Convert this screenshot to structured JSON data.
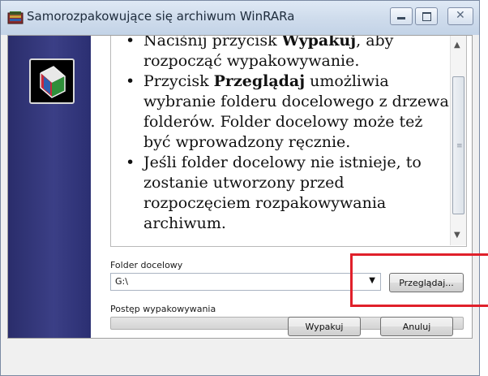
{
  "window": {
    "title": "Samorozpakowujące się archiwum WinRARa",
    "title_icon": "winrar-archive-icon",
    "controls": [
      "minimize",
      "maximize",
      "close"
    ]
  },
  "sidebar": {
    "logo": "winrar-books-logo"
  },
  "info": {
    "items": [
      {
        "before": "Naciśnij przycisk ",
        "bold": "Wypakuj",
        "after": ", aby rozpocząć wypakowywanie."
      },
      {
        "before": "Przycisk ",
        "bold": "Przeglądaj",
        "after": " umożliwia wybranie folderu docelowego z drzewa folderów. Folder docelowy może też być wprowadzony ręcznie."
      },
      {
        "before": "Jeśli folder docelowy nie istnieje, to zostanie utworzony przed rozpoczęciem rozpakowywania archiwum.",
        "bold": "",
        "after": ""
      }
    ]
  },
  "destination": {
    "label": "Folder docelowy",
    "value": "G:\\",
    "browse_label": "Przeglądaj..."
  },
  "progress": {
    "label": "Postęp wypakowywania",
    "fraction": 0
  },
  "footer": {
    "ok_label": "Wypakuj",
    "cancel_label": "Anuluj"
  },
  "colors": {
    "sidebar": "#2e327a",
    "annotation": "#e0202a"
  }
}
